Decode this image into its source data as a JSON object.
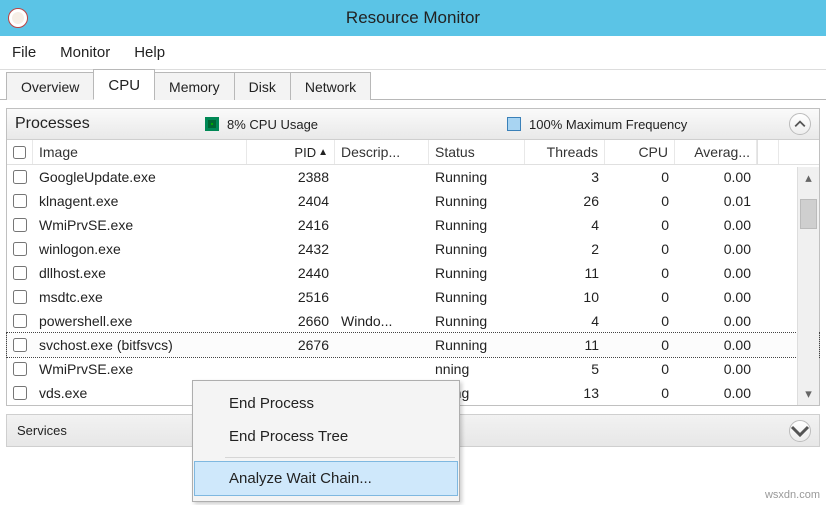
{
  "window": {
    "title": "Resource Monitor"
  },
  "menu": {
    "file": "File",
    "monitor": "Monitor",
    "help": "Help"
  },
  "tabs": {
    "overview": "Overview",
    "cpu": "CPU",
    "memory": "Memory",
    "disk": "Disk",
    "network": "Network",
    "active": "cpu"
  },
  "processes_panel": {
    "title": "Processes",
    "cpu_usage": "8% CPU Usage",
    "max_freq": "100% Maximum Frequency",
    "columns": {
      "image": "Image",
      "pid": "PID",
      "description": "Descrip...",
      "status": "Status",
      "threads": "Threads",
      "cpu": "CPU",
      "avg": "Averag..."
    },
    "sort_column": "pid",
    "rows": [
      {
        "image": "GoogleUpdate.exe",
        "pid": "2388",
        "description": "",
        "status": "Running",
        "threads": "3",
        "cpu": "0",
        "avg": "0.00",
        "selected": false
      },
      {
        "image": "klnagent.exe",
        "pid": "2404",
        "description": "",
        "status": "Running",
        "threads": "26",
        "cpu": "0",
        "avg": "0.01",
        "selected": false
      },
      {
        "image": "WmiPrvSE.exe",
        "pid": "2416",
        "description": "",
        "status": "Running",
        "threads": "4",
        "cpu": "0",
        "avg": "0.00",
        "selected": false
      },
      {
        "image": "winlogon.exe",
        "pid": "2432",
        "description": "",
        "status": "Running",
        "threads": "2",
        "cpu": "0",
        "avg": "0.00",
        "selected": false
      },
      {
        "image": "dllhost.exe",
        "pid": "2440",
        "description": "",
        "status": "Running",
        "threads": "11",
        "cpu": "0",
        "avg": "0.00",
        "selected": false
      },
      {
        "image": "msdtc.exe",
        "pid": "2516",
        "description": "",
        "status": "Running",
        "threads": "10",
        "cpu": "0",
        "avg": "0.00",
        "selected": false
      },
      {
        "image": "powershell.exe",
        "pid": "2660",
        "description": "Windo...",
        "status": "Running",
        "threads": "4",
        "cpu": "0",
        "avg": "0.00",
        "selected": false
      },
      {
        "image": "svchost.exe (bitfsvcs)",
        "pid": "2676",
        "description": "",
        "status": "Running",
        "threads": "11",
        "cpu": "0",
        "avg": "0.00",
        "selected": true
      },
      {
        "image": "WmiPrvSE.exe",
        "pid": "",
        "description": "",
        "status": "nning",
        "threads": "5",
        "cpu": "0",
        "avg": "0.00",
        "selected": false
      },
      {
        "image": "vds.exe",
        "pid": "",
        "description": "",
        "status": "nning",
        "threads": "13",
        "cpu": "0",
        "avg": "0.00",
        "selected": false
      }
    ]
  },
  "context_menu": {
    "end_process": "End Process",
    "end_tree": "End Process Tree",
    "analyze": "Analyze Wait Chain...",
    "highlighted": "analyze"
  },
  "services_panel": {
    "title": "Services"
  },
  "watermark": "wsxdn.com"
}
